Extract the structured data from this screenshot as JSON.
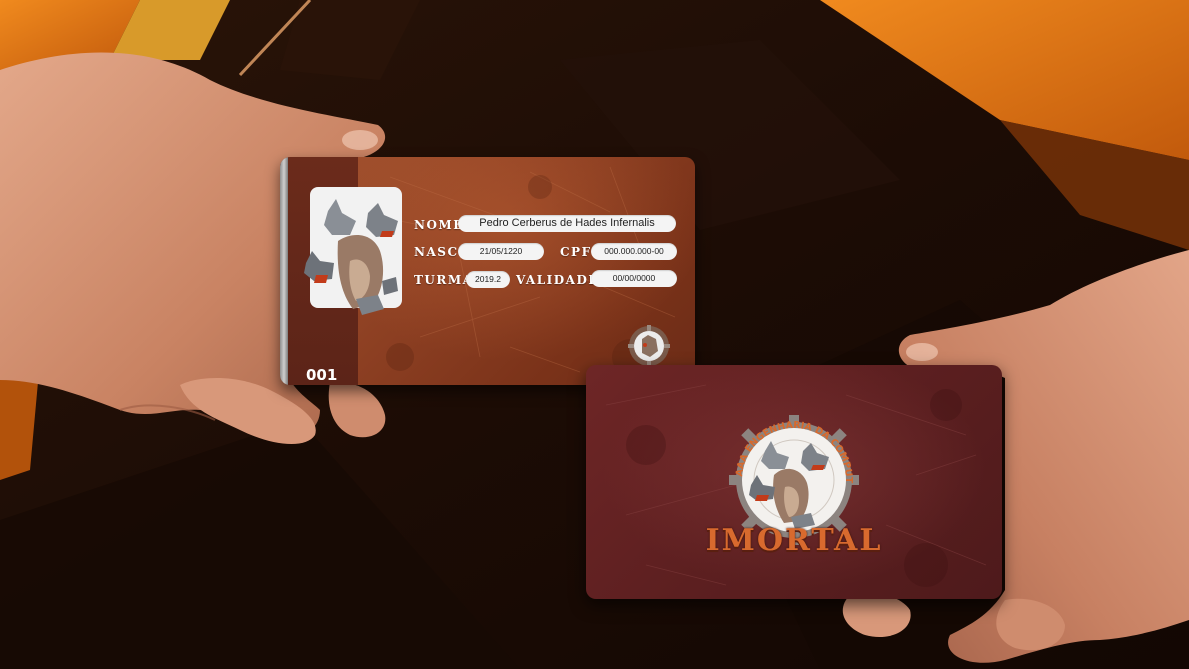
{
  "front_card": {
    "labels": {
      "name": "NOME",
      "birth": "NASC",
      "cpf": "CPF",
      "class": "TURMA",
      "validity": "VALIDADE"
    },
    "values": {
      "name": "Pedro Cerberus de Hades Infernalis",
      "birth": "21/05/1220",
      "cpf": "000.000.000-00",
      "class": "2019.2",
      "validity": "00/00/0000"
    },
    "number": "001"
  },
  "back_card": {
    "emblem_ring_text": "AAA ENGENHARIA DA COMPUTAÇÃO UFC SOBRAL",
    "brand": "IMORTAL"
  },
  "colors": {
    "accent_orange": "#e07a1c",
    "card_front": "#8c3f22",
    "card_back": "#5c1f20",
    "brand_text": "#d86a2e"
  }
}
